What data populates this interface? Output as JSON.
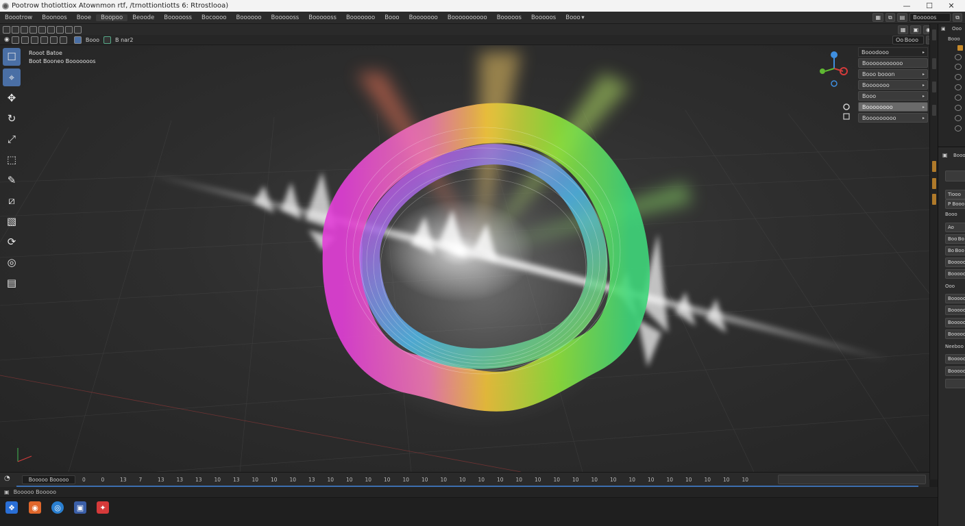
{
  "window": {
    "title": "Pootrow thotiottiox Atownmon rtf, /trnottiontiotts 6: Rtrostlooa)",
    "controls": [
      "—",
      "☐",
      "✕"
    ]
  },
  "menubar": {
    "items": [
      "Boootrow",
      "Boonoos",
      "Booe",
      "Boopoo",
      "Beoode",
      "Boooooss",
      "Bocoooo",
      "Boooooo",
      "Boooooss",
      "Boooooss",
      "Booooooo",
      "Booo",
      "Booooooo",
      "Boooooooooo",
      "Booooos",
      "Booooos",
      "Booo ▾"
    ],
    "active_index": 3,
    "right_field": "Booooos"
  },
  "header": {
    "mode_label": "Booo",
    "object_label": "B nar2"
  },
  "header_right": {
    "field": "Oo Booo"
  },
  "viewport_info": {
    "line1": "Rooot Batoe",
    "line2": "Boot Booneo Booooooos"
  },
  "tools": [
    {
      "icon": "select-box-icon",
      "glyph": "☐"
    },
    {
      "icon": "cursor-icon",
      "glyph": "⌖"
    },
    {
      "icon": "move-icon",
      "glyph": "✥"
    },
    {
      "icon": "rotate-icon",
      "glyph": "↻"
    },
    {
      "icon": "scale-icon",
      "glyph": "⤢"
    },
    {
      "icon": "transform-icon",
      "glyph": "⬚"
    },
    {
      "icon": "annotate-icon",
      "glyph": "✎"
    },
    {
      "icon": "measure-icon",
      "glyph": "⧄"
    },
    {
      "icon": "add-cube-icon",
      "glyph": "▧"
    },
    {
      "icon": "loop-icon",
      "glyph": "⟳"
    },
    {
      "icon": "shear-icon",
      "glyph": "◎"
    },
    {
      "icon": "extrude-icon",
      "glyph": "▤"
    }
  ],
  "npanel": {
    "header": "Booodooo",
    "items": [
      {
        "label": "Booooooooooo",
        "has_caret": false,
        "highlight": false
      },
      {
        "label": "Booo booon",
        "has_caret": true,
        "highlight": false
      },
      {
        "label": "Booooooo",
        "has_caret": true,
        "highlight": false
      },
      {
        "label": "Booo",
        "has_caret": true,
        "highlight": false
      },
      {
        "label": "Boooooooo",
        "has_caret": true,
        "highlight": true
      },
      {
        "label": "Booooooooo",
        "has_caret": true,
        "highlight": false
      }
    ]
  },
  "right_panel": {
    "top_label": "Ooo",
    "outliner_label": "Booo",
    "props_header": "Booo",
    "props": [
      "Tiooo",
      "P Booo",
      "Booo",
      "Ao",
      "Boo Bo",
      "Bo Boo",
      "Booooo",
      "Booooo",
      "Ooo",
      "Booooo",
      "Booooo",
      "Booooo",
      "Booooo",
      "Neeboo",
      "Booooo",
      "Booooo"
    ]
  },
  "timeline": {
    "field": "Booooo Booooo",
    "frames": [
      "0",
      "0",
      "13",
      "7",
      "13",
      "13",
      "13",
      "10",
      "13",
      "10",
      "10",
      "10",
      "13",
      "10",
      "10",
      "10",
      "10",
      "10",
      "10",
      "10",
      "10",
      "10",
      "10",
      "10",
      "10",
      "10",
      "10",
      "10",
      "10",
      "10",
      "10",
      "10",
      "10",
      "10",
      "10",
      "10"
    ]
  },
  "statusbar": {
    "text": "Booooo Booooo"
  },
  "dock": [
    {
      "icon": "shield-app-icon",
      "color": "#2a6fd6",
      "glyph": "❖"
    },
    {
      "icon": "photo-app-icon",
      "color": "#e0672b",
      "glyph": "◉"
    },
    {
      "icon": "globe-app-icon",
      "color": "#2a7fd0",
      "glyph": "◎"
    },
    {
      "icon": "monitor-app-icon",
      "color": "#3b5fa8",
      "glyph": "▣"
    },
    {
      "icon": "tool-app-icon",
      "color": "#d63a3a",
      "glyph": "✦"
    }
  ],
  "colors": {
    "accent": "#4a6fa5",
    "timeline_track": "#3d6fb0",
    "gizmo_x": "#d43b3b",
    "gizmo_y": "#5fb832",
    "gizmo_z": "#3f8fe0"
  }
}
